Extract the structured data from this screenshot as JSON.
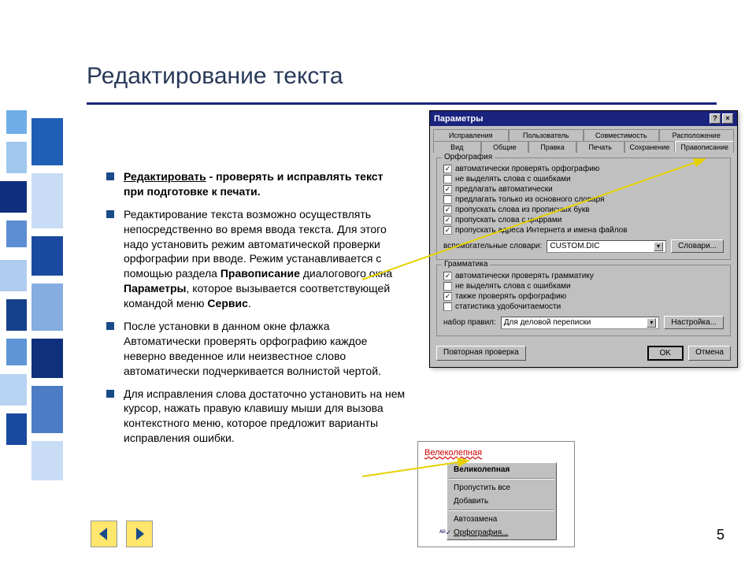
{
  "title": "Редактирование текста",
  "bullets": [
    {
      "lead_bold": true,
      "lead": "Редактировать",
      "text": " - проверять и исправлять текст при подготовке к печати."
    },
    {
      "text": "Редактирование текста возможно осуществлять непосредственно во время ввода текста. Для этого надо установить режим автоматической проверки орфографии при вводе. Режим устанавливается с помощью раздела ",
      "bold1": "Правописание",
      "mid": " диалогового окна ",
      "bold2": "Параметры",
      "tail": ", которое вызывается соответствующей командой меню ",
      "bold3": "Сервис",
      "end": "."
    },
    {
      "text": "После установки в данном окне флажка Автоматически проверять орфографию каждое неверно введенное или неизвестное слово автоматически подчеркивается волнистой чертой."
    },
    {
      "text": "Для исправления слова достаточно установить на нем курсор, нажать правую клавишу мыши для вызова контекстного меню, которое предложит варианты исправления ошибки."
    }
  ],
  "dialog": {
    "title": "Параметры",
    "tabs_row1": [
      "Исправления",
      "Пользователь",
      "Совместимость",
      "Расположение"
    ],
    "tabs_row2": [
      "Вид",
      "Общие",
      "Правка",
      "Печать",
      "Сохранение",
      "Правописание"
    ],
    "active_tab": "Правописание",
    "group_spell": {
      "label": "Орфография",
      "checks": [
        {
          "checked": true,
          "label": "автоматически проверять орфографию"
        },
        {
          "checked": false,
          "label": "не выделять слова с ошибками"
        },
        {
          "checked": true,
          "label": "предлагать автоматически"
        },
        {
          "checked": false,
          "label": "предлагать только из основного словаря"
        },
        {
          "checked": true,
          "label": "пропускать слова из прописных букв"
        },
        {
          "checked": true,
          "label": "пропускать слова с цифрами"
        },
        {
          "checked": true,
          "label": "пропускать адреса Интернета и имена файлов"
        }
      ],
      "aux_label": "вспомогательные словари:",
      "aux_value": "CUSTOM.DIC",
      "aux_btn": "Словари..."
    },
    "group_grammar": {
      "label": "Грамматика",
      "checks": [
        {
          "checked": true,
          "label": "автоматически проверять грамматику"
        },
        {
          "checked": false,
          "label": "не выделять слова с ошибками"
        },
        {
          "checked": true,
          "label": "также проверять орфографию"
        },
        {
          "checked": false,
          "label": "статистика удобочитаемости"
        }
      ],
      "rules_label": "набор правил:",
      "rules_value": "Для деловой переписки",
      "rules_btn": "Настройка..."
    },
    "recheck_btn": "Повторная проверка",
    "ok_btn": "OK",
    "cancel_btn": "Отмена"
  },
  "context": {
    "misspelled": "Велеколепная",
    "items": [
      "Великолепная",
      "Пропустить все",
      "Добавить",
      "Автозамена",
      "Орфография..."
    ]
  },
  "page_number": "5"
}
